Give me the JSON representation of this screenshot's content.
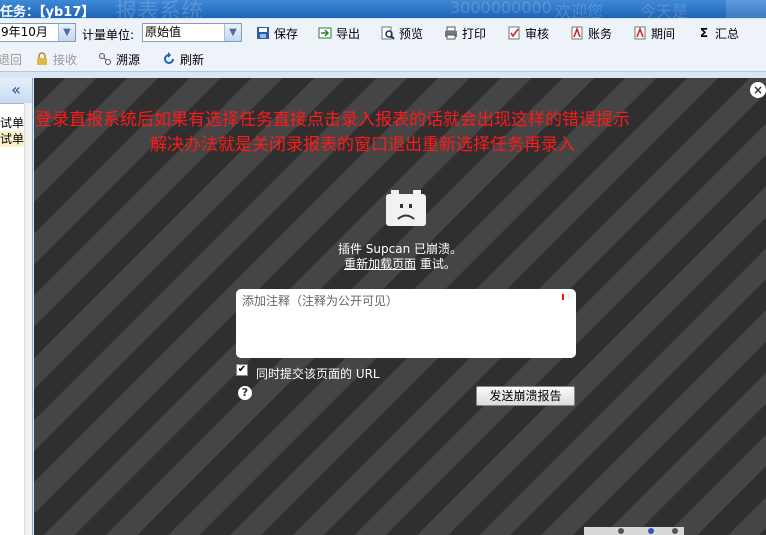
{
  "titlebar": {
    "label": "任务：【yb17】",
    "ghost_title": "报表系统",
    "ghost_items": [
      "3000000000",
      "欢迎您",
      "今天是"
    ]
  },
  "toolbar": {
    "period_value": "9年10月",
    "unit_label": "计量单位:",
    "unit_value": "原始值",
    "buttons": [
      {
        "label": "保存",
        "icon": "save-icon"
      },
      {
        "label": "导出",
        "icon": "export-icon"
      },
      {
        "label": "预览",
        "icon": "preview-icon"
      },
      {
        "label": "打印",
        "icon": "print-icon"
      },
      {
        "label": "审核",
        "icon": "audit-icon"
      },
      {
        "label": "账务",
        "icon": "accounts-icon"
      },
      {
        "label": "期间",
        "icon": "period-icon"
      },
      {
        "label": "汇总",
        "icon": "sum-icon"
      }
    ],
    "row2": [
      {
        "label": "退回",
        "icon": "return-icon",
        "enabled": false
      },
      {
        "label": "接收",
        "icon": "lock-icon",
        "enabled": false
      },
      {
        "label": "溯源",
        "icon": "trace-icon",
        "enabled": true
      },
      {
        "label": "刷新",
        "icon": "refresh-icon",
        "enabled": true
      }
    ]
  },
  "leftpanel": {
    "collapse_glyph": "«",
    "items": [
      "试单位",
      "试单位"
    ]
  },
  "crash": {
    "annotation_line1": "登录直报系统后如果有选择任务直接点击录入报表的话就会出现这样的错误提示",
    "annotation_line2": "解决办法就是关闭录报表的窗口退出重新选择任务再录入",
    "message": "插件 Supcan 已崩溃。",
    "reload_link": "重新加载页面",
    "retry_suffix": " 重试。",
    "comment_placeholder": "添加注释（注释为公开可见）",
    "submit_url_label": "同时提交该页面的 URL",
    "submit_url_checked": true,
    "send_button": "发送崩溃报告",
    "help_glyph": "?",
    "close_glyph": "×"
  }
}
